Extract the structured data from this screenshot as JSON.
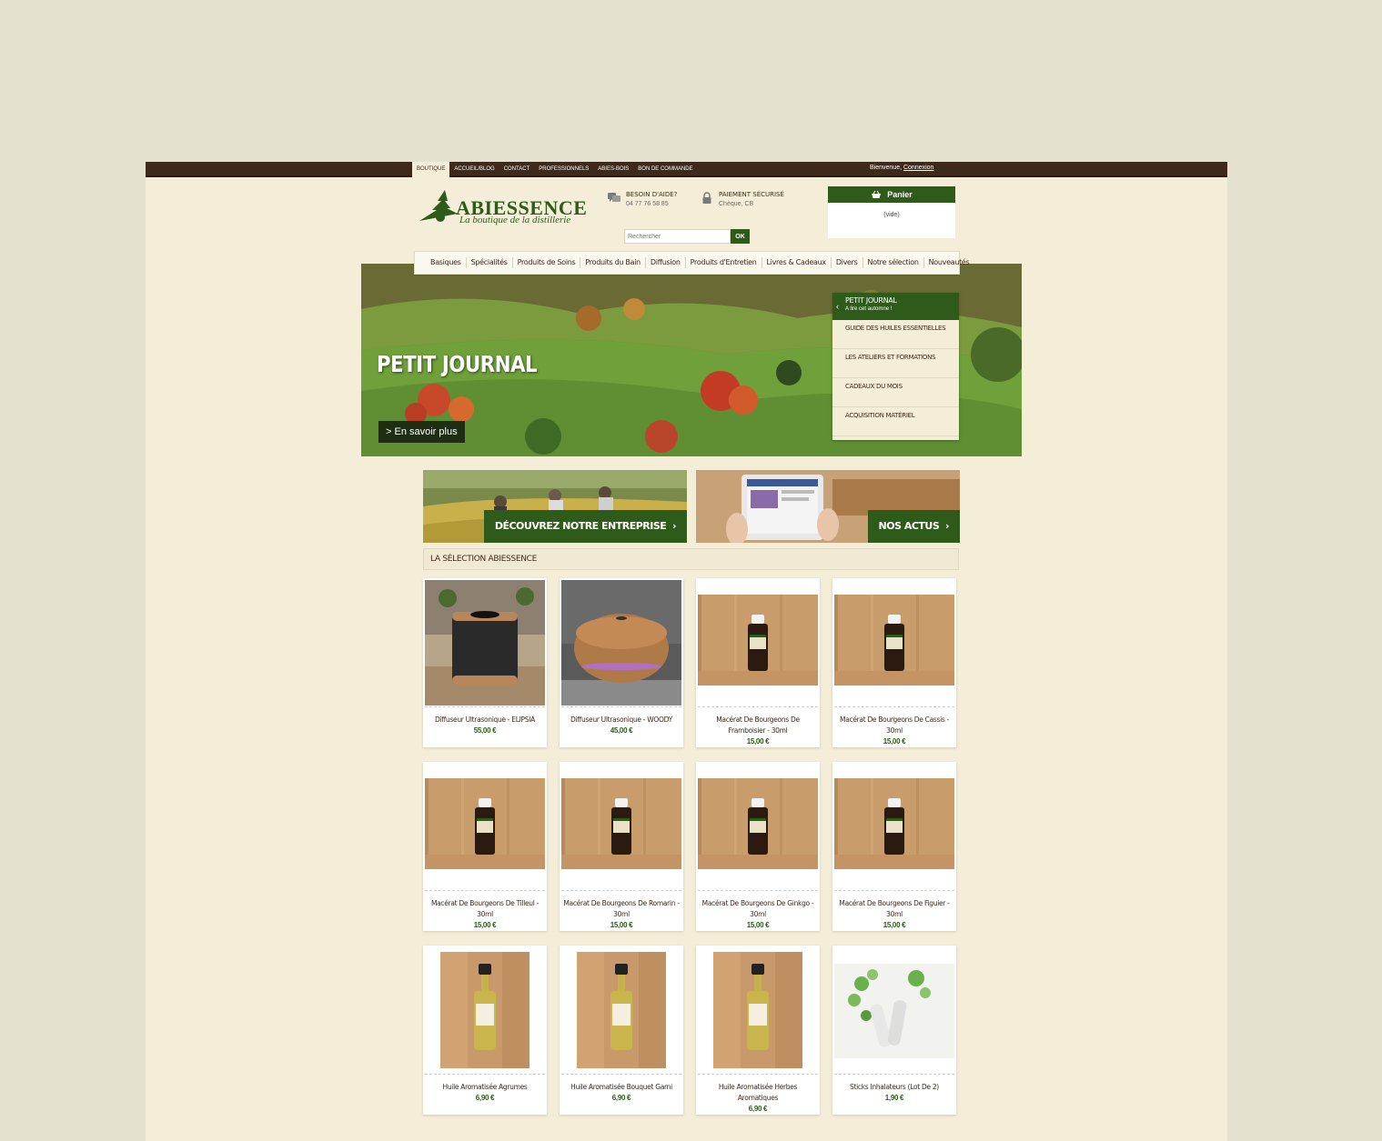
{
  "topnav": {
    "items": [
      "BOUTIQUE",
      "ACCUEIL/BLOG",
      "CONTACT",
      "PROFESSIONNELS",
      "ABIES-BOIS",
      "BON DE COMMANDE"
    ],
    "welcome": "Bienvenue,",
    "login": "Connexion"
  },
  "logo": {
    "title": "ABIESSENCE",
    "subtitle": "La boutique de la distillerie"
  },
  "help": {
    "title": "BESOIN D'AIDE?",
    "phone": "04 77 76 58 85"
  },
  "payment": {
    "title": "PAIEMENT SÉCURISÉ",
    "methods": "Chèque, CB"
  },
  "search": {
    "placeholder": "Rechercher",
    "button": "OK"
  },
  "cart": {
    "title": "Panier",
    "status": "(vide)"
  },
  "mainnav": [
    "Basiques",
    "Spécialités",
    "Produits de Soins",
    "Produits du Bain",
    "Diffusion",
    "Produits d'Entretien",
    "Livres & Cadeaux",
    "Divers",
    "Notre sélection",
    "Nouveautés"
  ],
  "hero": {
    "title": "PETIT JOURNAL",
    "button": "> En savoir plus"
  },
  "journal": {
    "title": "PETIT JOURNAL",
    "subtitle": "A lire cet automne !",
    "items": [
      "GUIDE DES HUILES ESSENTIELLES",
      "LES ATELIERS ET FORMATIONS",
      "CADEAUX DU MOIS",
      "ACQUISITION MATÉRIEL"
    ]
  },
  "promos": [
    {
      "label": "DÉCOUVREZ NOTRE ENTREPRISE"
    },
    {
      "label": "NOS ACTUS"
    }
  ],
  "selection_title": "LA SÉLECTION ABIESSENCE",
  "products": [
    {
      "name": "Diffuseur Ultrasonique - ELIPSIA",
      "price": "55,00 €"
    },
    {
      "name": "Diffuseur Ultrasonique - WOODY",
      "price": "45,00 €"
    },
    {
      "name": "Macérat De Bourgeons De Framboisier - 30ml",
      "price": "15,00 €"
    },
    {
      "name": "Macérat De Bourgeons De Cassis - 30ml",
      "price": "15,00 €"
    },
    {
      "name": "Macérat De Bourgeons De Tilleul - 30ml",
      "price": "15,00 €"
    },
    {
      "name": "Macérat De Bourgeons De Romarin - 30ml",
      "price": "15,00 €"
    },
    {
      "name": "Macérat De Bourgeons De Ginkgo - 30ml",
      "price": "15,00 €"
    },
    {
      "name": "Macérat De Bourgeons De Figuier - 30ml",
      "price": "15,00 €"
    },
    {
      "name": "Huile Aromatisée Agrumes",
      "price": "6,90 €"
    },
    {
      "name": "Huile Aromatisée Bouquet Garni",
      "price": "6,90 €"
    },
    {
      "name": "Huile Aromatisée Herbes Aromatiques",
      "price": "6,90 €"
    },
    {
      "name": "Sticks Inhalateurs (Lot De 2)",
      "price": "1,90 €"
    }
  ]
}
